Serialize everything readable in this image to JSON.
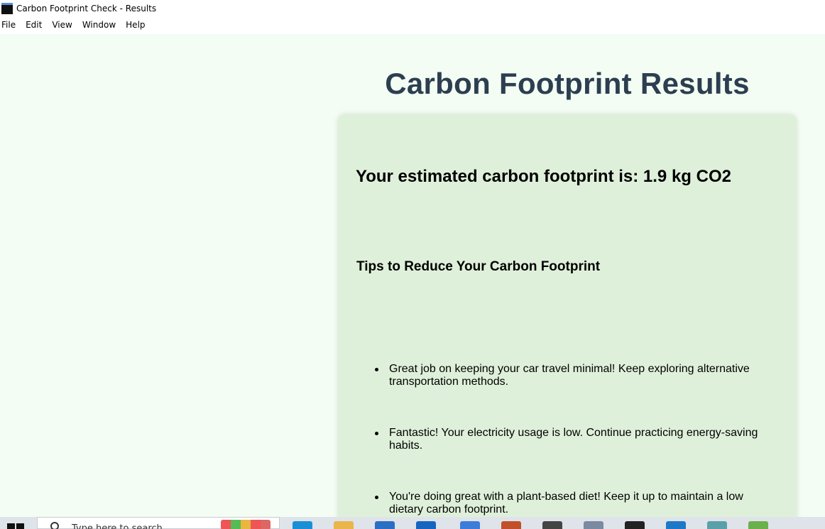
{
  "window": {
    "title": "Carbon Footprint Check - Results"
  },
  "menu": [
    "File",
    "Edit",
    "View",
    "Window",
    "Help"
  ],
  "page": {
    "title": "Carbon Footprint Results",
    "result": "Your estimated carbon footprint is: 1.9 kg CO2",
    "tips_heading": "Tips to Reduce Your Carbon Footprint",
    "tips": [
      "Great job on keeping your car travel minimal! Keep exploring alternative transportation methods.",
      "Fantastic! Your electricity usage is low. Continue practicing energy-saving habits.",
      "You're doing great with a plant-based diet! Keep it up to maintain a low dietary carbon footprint."
    ]
  },
  "taskbar": {
    "search_placeholder": "Type here to search",
    "apps": [
      {
        "icon": "edge-icon",
        "color": "#1a8fd6"
      },
      {
        "icon": "file-explorer-icon",
        "color": "#e8b64a"
      },
      {
        "icon": "store-icon",
        "color": "#2a6fc4"
      },
      {
        "icon": "outlook-icon",
        "color": "#1565c0"
      },
      {
        "icon": "media-player-icon",
        "color": "#3c7dd9"
      },
      {
        "icon": "matlab-icon",
        "color": "#c0502a"
      },
      {
        "icon": "inkscape-icon",
        "color": "#444444"
      },
      {
        "icon": "notepad-icon",
        "color": "#7a8aa0"
      },
      {
        "icon": "terminal-icon",
        "color": "#222222"
      },
      {
        "icon": "vscode-icon",
        "color": "#1e78c8"
      },
      {
        "icon": "python-app-icon",
        "color": "#5aa0a8"
      },
      {
        "icon": "paint-icon",
        "color": "#6ab04c"
      }
    ]
  }
}
